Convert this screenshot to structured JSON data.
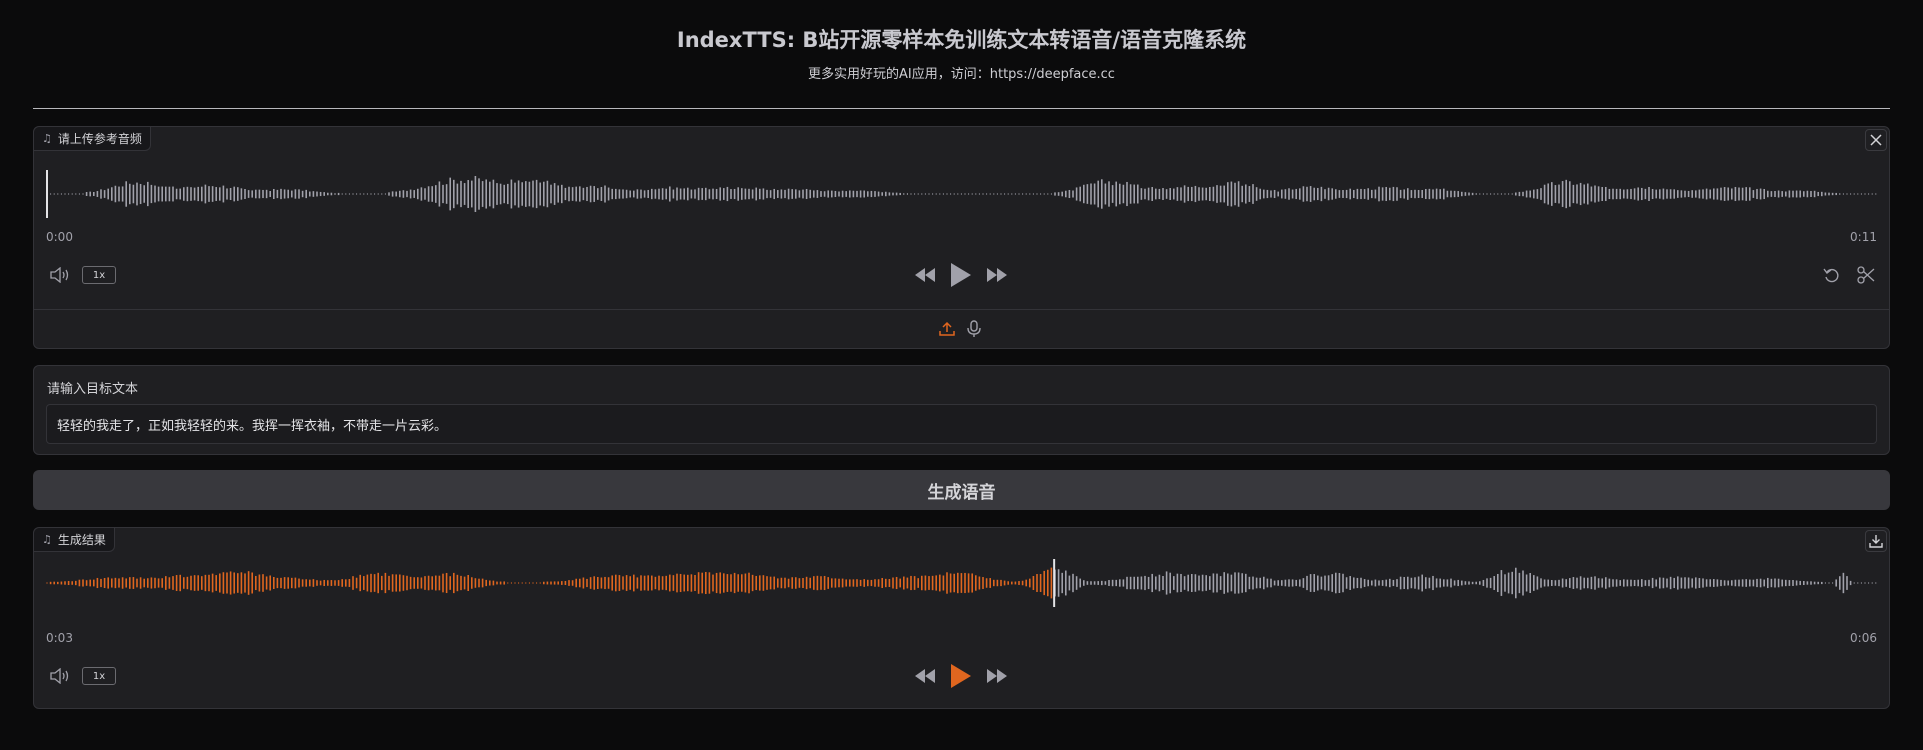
{
  "header": {
    "title": "IndexTTS: B站开源零样本免训练文本转语音/语音克隆系统",
    "subtitle": "更多实用好玩的AI应用，访问：https://deepface.cc"
  },
  "reference_audio": {
    "label": "请上传参考音频",
    "time_start": "0:00",
    "time_end": "0:11",
    "playback_rate": "1x",
    "progress": 0.0
  },
  "text_input": {
    "label": "请输入目标文本",
    "value": "轻轻的我走了，正如我轻轻的来。我挥一挥衣袖，不带走一片云彩。"
  },
  "generate_button": {
    "label": "生成语音"
  },
  "result_audio": {
    "label": "生成结果",
    "time_current": "0:03",
    "time_end": "0:06",
    "playback_rate": "1x",
    "progress": 0.55
  },
  "colors": {
    "accent": "#e0661f",
    "wave_idle": "#a1a1aa",
    "panel_bg": "#1f1f22",
    "page_bg": "#0b0b0c"
  },
  "icons": {
    "music_note": "music-note-icon",
    "close": "close-icon",
    "volume": "volume-icon",
    "rewind": "rewind-icon",
    "play": "play-icon",
    "fast_forward": "fast-forward-icon",
    "undo": "undo-icon",
    "scissors": "scissors-icon",
    "upload": "upload-icon",
    "microphone": "microphone-icon",
    "download": "download-icon"
  }
}
